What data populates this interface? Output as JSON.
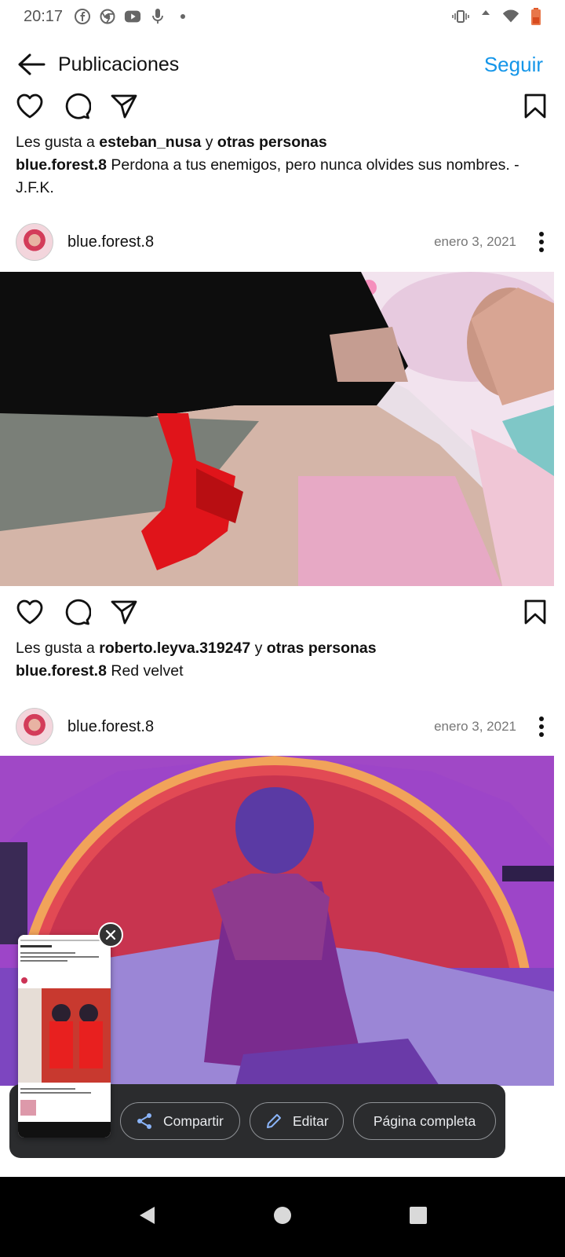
{
  "status_bar": {
    "time": "20:17",
    "left_icons": [
      "facebook-icon",
      "chrome-icon",
      "youtube-icon",
      "mic-icon",
      "dot-icon"
    ],
    "right_icons": [
      "vibrate-icon",
      "signal-icon",
      "wifi-icon",
      "battery-icon"
    ]
  },
  "header": {
    "title": "Publicaciones",
    "follow_label": "Seguir"
  },
  "post1": {
    "likes_prefix": "Les gusta a ",
    "liker": "esteban_nusa",
    "likes_middle": " y ",
    "likes_others": "otras personas",
    "caption_user": "blue.forest.8",
    "caption_text": " Perdona a tus enemigos, pero nunca olvides sus nombres. -J.F.K."
  },
  "post2": {
    "username": "blue.forest.8",
    "date": "enero 3, 2021",
    "likes_prefix": "Les gusta a ",
    "liker": "roberto.leyva.319247",
    "likes_middle": " y ",
    "likes_others": "otras personas",
    "caption_user": "blue.forest.8",
    "caption_text": " Red velvet"
  },
  "post3": {
    "username": "blue.forest.8",
    "date": "enero 3, 2021"
  },
  "screenshot_toolbar": {
    "share_label": "Compartir",
    "edit_label": "Editar",
    "fullpage_label": "Página completa"
  },
  "colors": {
    "accent": "#1596e9",
    "panel": "#2b2c2e"
  }
}
